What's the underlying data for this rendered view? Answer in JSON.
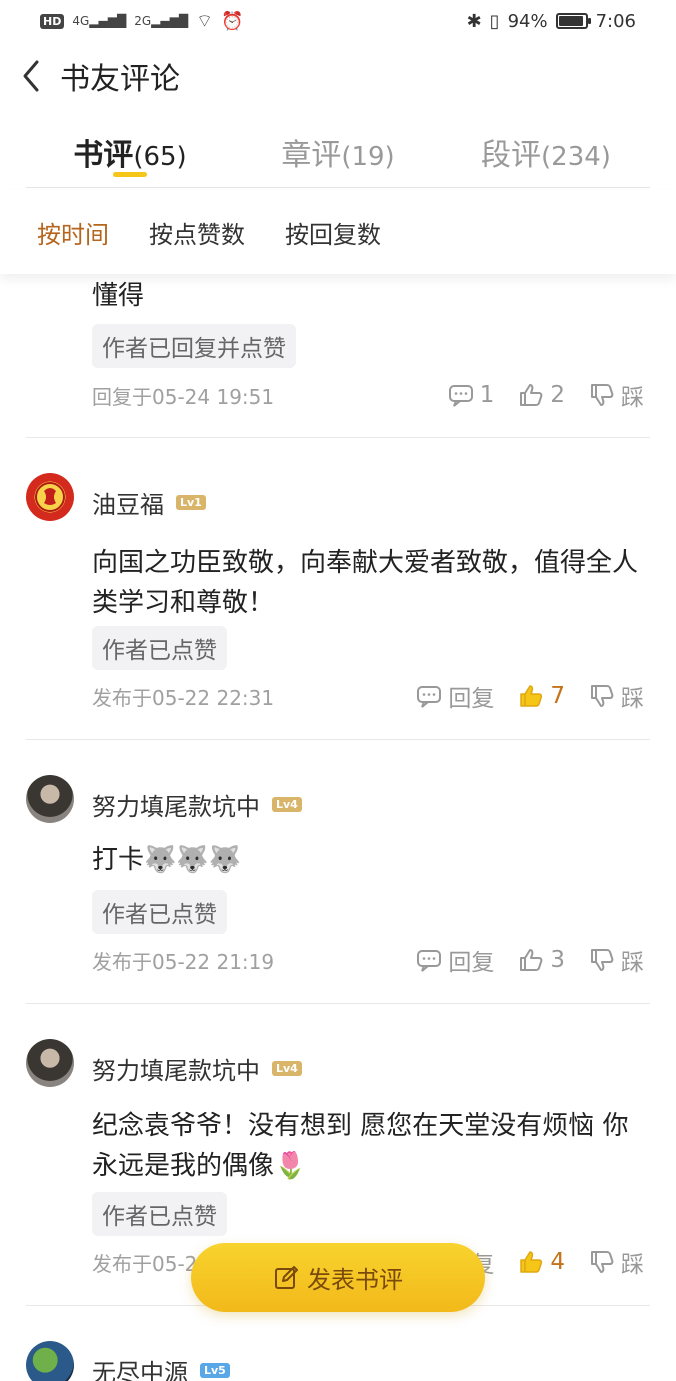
{
  "status_bar": {
    "signal_1": "4G",
    "signal_2": "2G",
    "battery": "94%",
    "battery_level": 0.94,
    "time": "7:06"
  },
  "header": {
    "title": "书友评论"
  },
  "tabs": [
    {
      "name": "书评",
      "count": "(65)",
      "active": true
    },
    {
      "name": "章评",
      "count": "(19)",
      "active": false
    },
    {
      "name": "段评",
      "count": "(234)",
      "active": false
    }
  ],
  "sort": [
    {
      "label": "按时间",
      "active": true
    },
    {
      "label": "按点赞数",
      "active": false
    },
    {
      "label": "按回复数",
      "active": false
    }
  ],
  "comments": [
    {
      "text": "懂得",
      "tag": "作者已回复并点赞",
      "time": "回复于05-24 19:51",
      "reply_label": "1",
      "likes": "2",
      "liked": false,
      "dislike_label": "踩"
    },
    {
      "username": "油豆福",
      "level": "Lv1",
      "text": "向国之功臣致敬，向奉献大爱者致敬，值得全人类学习和尊敬！",
      "tag": "作者已点赞",
      "time": "发布于05-22 22:31",
      "reply_label": "回复",
      "likes": "7",
      "liked": true,
      "dislike_label": "踩"
    },
    {
      "username": "努力填尾款坑中",
      "level": "Lv4",
      "text": "打卡🐺🐺🐺",
      "tag": "作者已点赞",
      "time": "发布于05-22 21:19",
      "reply_label": "回复",
      "likes": "3",
      "liked": false,
      "dislike_label": "踩"
    },
    {
      "username": "努力填尾款坑中",
      "level": "Lv4",
      "text": "纪念袁爷爷！没有想到 愿您在天堂没有烦恼 你永远是我的偶像🌷",
      "tag": "作者已点赞",
      "time": "发布于05-2",
      "reply_label": "复",
      "likes": "4",
      "liked": true,
      "dislike_label": "踩"
    },
    {
      "username": "无尽中源",
      "level": "Lv5"
    }
  ],
  "post_button": {
    "label": "发表书评"
  },
  "colors": {
    "accent": "#f5c518",
    "liked": "#c4731a",
    "sort_active": "#b5651d"
  }
}
